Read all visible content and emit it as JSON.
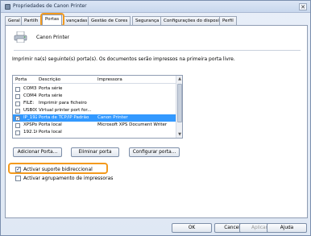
{
  "window": {
    "title": "Propriedades de Canon Printer",
    "close_glyph": "✕"
  },
  "tabs": [
    {
      "label": "Geral"
    },
    {
      "label": "Partilh"
    },
    {
      "label": "Portas"
    },
    {
      "label": "vançadas"
    },
    {
      "label": "Gestão de Cores"
    },
    {
      "label": "Segurança"
    },
    {
      "label": "Configurações do dispositivo"
    },
    {
      "label": "Perfil"
    }
  ],
  "printer_name": "Canon Printer",
  "instruction": "Imprimir na(s) seguinte(s) porta(s). Os documentos serão impressos na primeira porta livre.",
  "port_list": {
    "headers": {
      "port": "Porta",
      "description": "Descrição",
      "printer": "Impressora"
    },
    "rows": [
      {
        "checked": false,
        "port": "COM3:",
        "description": "Porta série",
        "printer": ""
      },
      {
        "checked": false,
        "port": "COM4:",
        "description": "Porta série",
        "printer": ""
      },
      {
        "checked": false,
        "port": "FILE:",
        "description": "Imprimir para ficheiro",
        "printer": ""
      },
      {
        "checked": false,
        "port": "USB001",
        "description": "Virtual printer port for...",
        "printer": ""
      },
      {
        "checked": true,
        "port": "IP_192...",
        "description": "Porta de TCP/IP Padrão",
        "printer": "Canon Printer",
        "selected": true
      },
      {
        "checked": false,
        "port": "XPSPort:",
        "description": "Porta local",
        "printer": "Microsoft XPS Document Writer"
      },
      {
        "checked": false,
        "port": "192.16...",
        "description": "Porta local",
        "printer": ""
      },
      {
        "checked": false,
        "port": "",
        "description": "",
        "printer": ""
      }
    ]
  },
  "buttons": {
    "add_port": "Adicionar Porta...",
    "delete_port": "Eliminar porta",
    "configure_port": "Configurar porta..."
  },
  "options": {
    "bidirectional": {
      "label": "Activar suporte bidireccional",
      "checked": true
    },
    "pooling": {
      "label": "Activar agrupamento de impressoras",
      "checked": false
    }
  },
  "footer": {
    "ok": "OK",
    "cancel": "Cancelar",
    "apply": "Aplicar",
    "help": "Ajuda"
  },
  "colors": {
    "highlight": "#f39a1d",
    "selection": "#3399ff"
  }
}
